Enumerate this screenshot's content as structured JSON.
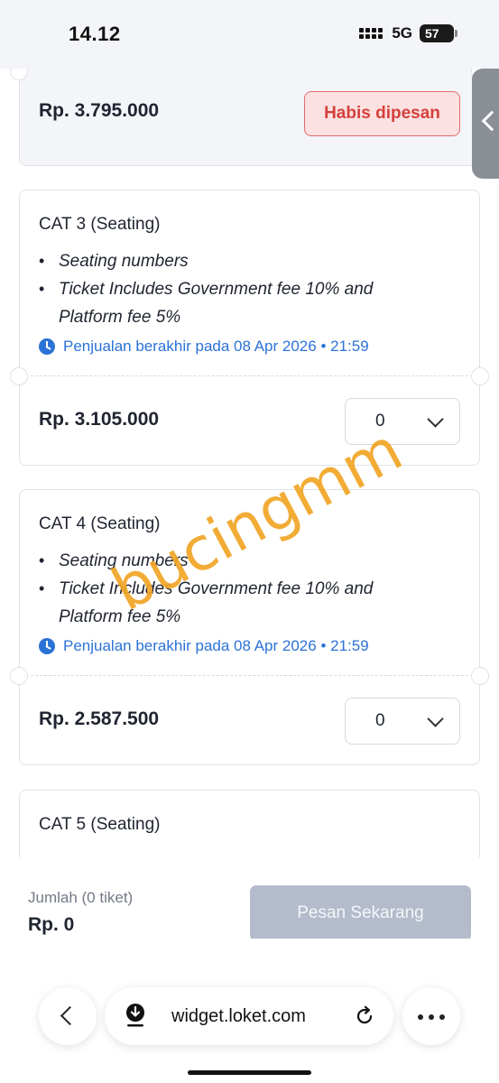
{
  "status": {
    "time": "14.12",
    "network": "5G",
    "battery": "57"
  },
  "tickets": [
    {
      "price": "Rp. 3.795.000",
      "sold_label": "Habis dipesan"
    },
    {
      "title": "CAT 3 (Seating)",
      "bullets": [
        "Seating numbers",
        "Ticket Includes Government fee 10% and Platform fee 5%"
      ],
      "sale_end": "Penjualan berakhir pada 08 Apr 2026 • 21:59",
      "price": "Rp. 3.105.000",
      "qty": "0"
    },
    {
      "title": "CAT 4 (Seating)",
      "bullets": [
        "Seating numbers",
        "Ticket Includes Government fee 10% and Platform fee 5%"
      ],
      "sale_end": "Penjualan berakhir pada 08 Apr 2026 • 21:59",
      "price": "Rp. 2.587.500",
      "qty": "0"
    },
    {
      "title": "CAT 5 (Seating)"
    }
  ],
  "watermark": "bucingmm",
  "order": {
    "count_label": "Jumlah (0 tiket)",
    "total": "Rp. 0",
    "button_label": "Pesan Sekarang"
  },
  "browser": {
    "url": "widget.loket.com"
  },
  "icons": [
    "signal-icon",
    "battery-icon",
    "clock-icon",
    "chevron-down-icon",
    "chevron-left-icon",
    "download-icon",
    "reload-icon",
    "more-icon"
  ],
  "colors": {
    "accent_blue": "#2b72d7",
    "sold_red": "#d6403c",
    "disabled_button": "#b4bccb",
    "watermark": "#f1a625"
  }
}
